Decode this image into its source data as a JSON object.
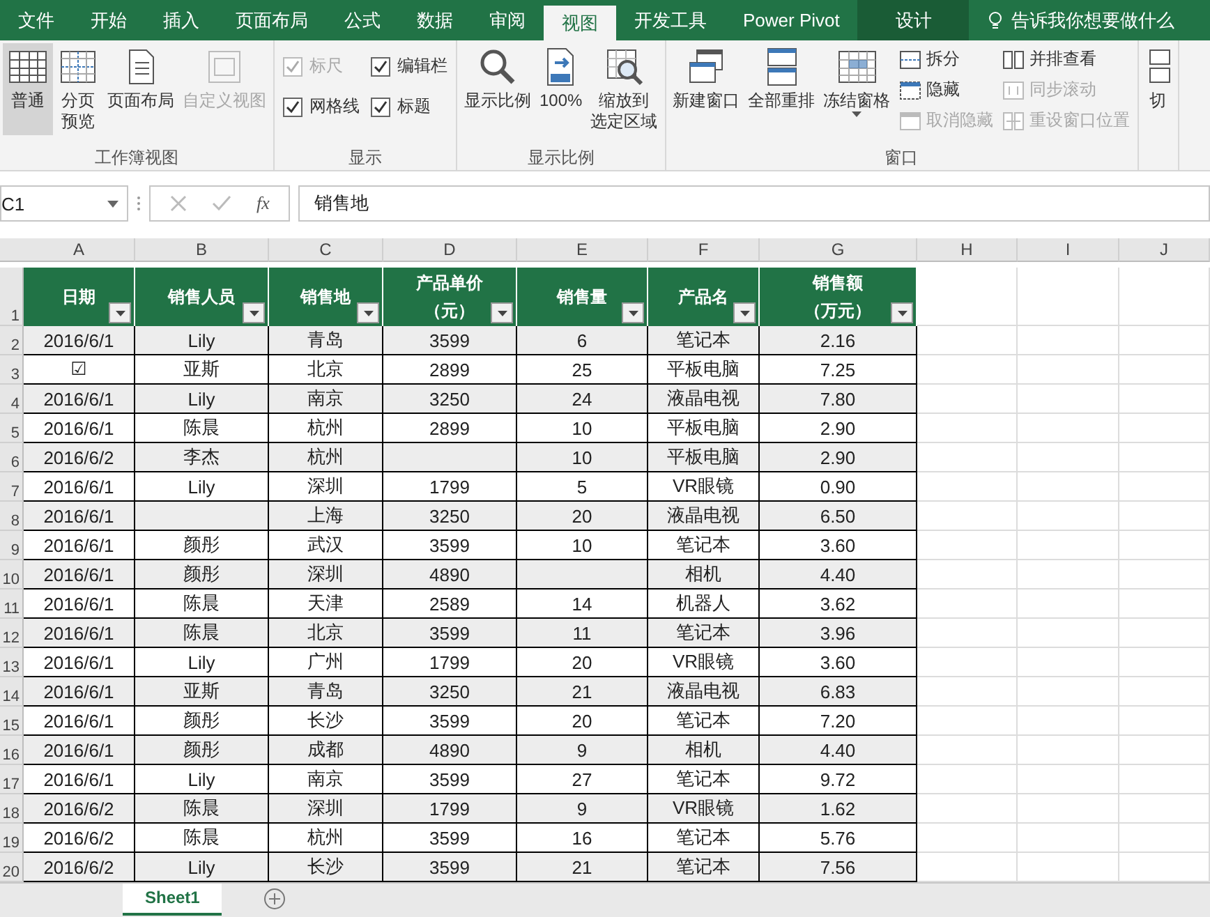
{
  "tabs": [
    {
      "label": "文件",
      "selected": false,
      "kind": "normal"
    },
    {
      "label": "开始",
      "selected": false,
      "kind": "normal"
    },
    {
      "label": "插入",
      "selected": false,
      "kind": "normal"
    },
    {
      "label": "页面布局",
      "selected": false,
      "kind": "normal"
    },
    {
      "label": "公式",
      "selected": false,
      "kind": "normal"
    },
    {
      "label": "数据",
      "selected": false,
      "kind": "normal"
    },
    {
      "label": "审阅",
      "selected": false,
      "kind": "normal"
    },
    {
      "label": "视图",
      "selected": true,
      "kind": "normal"
    },
    {
      "label": "开发工具",
      "selected": false,
      "kind": "normal"
    },
    {
      "label": "Power Pivot",
      "selected": false,
      "kind": "normal"
    },
    {
      "label": "设计",
      "selected": false,
      "kind": "contextual"
    }
  ],
  "tell_me": {
    "text": "告诉我你想要做什么"
  },
  "ribbon_groups": [
    {
      "label": "工作簿视图",
      "items": [
        {
          "kind": "large",
          "lines": [
            "普通"
          ],
          "selected": true,
          "disabled": false
        },
        {
          "kind": "large",
          "lines": [
            "分页",
            "预览"
          ],
          "selected": false,
          "disabled": false
        },
        {
          "kind": "large",
          "lines": [
            "页面布局"
          ],
          "selected": false,
          "disabled": false
        },
        {
          "kind": "large",
          "lines": [
            "自定义视图"
          ],
          "selected": false,
          "disabled": true
        }
      ]
    },
    {
      "label": "显示",
      "items": [
        {
          "kind": "check",
          "lines": [
            "标尺"
          ],
          "checked": true,
          "disabled": true
        },
        {
          "kind": "check",
          "lines": [
            "编辑栏"
          ],
          "checked": true,
          "disabled": false
        },
        {
          "kind": "check",
          "lines": [
            "网格线"
          ],
          "checked": true,
          "disabled": false
        },
        {
          "kind": "check",
          "lines": [
            "标题"
          ],
          "checked": true,
          "disabled": false
        }
      ]
    },
    {
      "label": "显示比例",
      "items": [
        {
          "kind": "large",
          "lines": [
            "显示比例"
          ],
          "disabled": false
        },
        {
          "kind": "large",
          "lines": [
            "100%"
          ],
          "disabled": false
        },
        {
          "kind": "large",
          "lines": [
            "缩放到",
            "选定区域"
          ],
          "disabled": false
        }
      ]
    },
    {
      "label": "窗口",
      "items": [
        {
          "kind": "large",
          "lines": [
            "新建窗口"
          ],
          "disabled": false
        },
        {
          "kind": "large",
          "lines": [
            "全部重排"
          ],
          "disabled": false
        },
        {
          "kind": "large",
          "lines": [
            "冻结窗格"
          ],
          "disabled": false,
          "dropdown": true
        },
        {
          "kind": "small",
          "lines": [
            "拆分"
          ],
          "disabled": false
        },
        {
          "kind": "small",
          "lines": [
            "隐藏"
          ],
          "disabled": false
        },
        {
          "kind": "small",
          "lines": [
            "取消隐藏"
          ],
          "disabled": true
        },
        {
          "kind": "small",
          "lines": [
            "并排查看"
          ],
          "disabled": false
        },
        {
          "kind": "small",
          "lines": [
            "同步滚动"
          ],
          "disabled": true
        },
        {
          "kind": "small",
          "lines": [
            "重设窗口位置"
          ],
          "disabled": true
        }
      ]
    },
    {
      "items": [
        {
          "kind": "large",
          "lines": [
            "切"
          ],
          "disabled": false
        }
      ]
    }
  ],
  "formula_bar": {
    "name_box": "C1",
    "fx": "fx",
    "formula": "销售地"
  },
  "sheet": {
    "columns": [
      "A",
      "B",
      "C",
      "D",
      "E",
      "F",
      "G",
      "H",
      "I",
      "J"
    ],
    "row_numbers": [
      "1",
      "2",
      "3",
      "4",
      "5",
      "6",
      "7",
      "8",
      "9",
      "10",
      "11",
      "12",
      "13",
      "14",
      "15",
      "16",
      "17",
      "18",
      "19",
      "20"
    ],
    "header": [
      [
        "日期"
      ],
      [
        "销售人员"
      ],
      [
        "销售地"
      ],
      [
        "产品单价",
        "（元）"
      ],
      [
        "销售量"
      ],
      [
        "产品名"
      ],
      [
        "销售额",
        "（万元）"
      ]
    ],
    "rows": [
      [
        "2016/6/1",
        "Lily",
        "青岛",
        "3599",
        "6",
        "笔记本",
        "2.16"
      ],
      [
        "☑",
        "亚斯",
        "北京",
        "2899",
        "25",
        "平板电脑",
        "7.25"
      ],
      [
        "2016/6/1",
        "Lily",
        "南京",
        "3250",
        "24",
        "液晶电视",
        "7.80"
      ],
      [
        "2016/6/1",
        "陈晨",
        "杭州",
        "2899",
        "10",
        "平板电脑",
        "2.90"
      ],
      [
        "2016/6/2",
        "李杰",
        "杭州",
        null,
        "10",
        "平板电脑",
        "2.90"
      ],
      [
        "2016/6/1",
        "Lily",
        "深圳",
        "1799",
        "5",
        "VR眼镜",
        "0.90"
      ],
      [
        "2016/6/1",
        null,
        "上海",
        "3250",
        "20",
        "液晶电视",
        "6.50"
      ],
      [
        "2016/6/1",
        "颜彤",
        "武汉",
        "3599",
        "10",
        "笔记本",
        "3.60"
      ],
      [
        "2016/6/1",
        "颜彤",
        "深圳",
        "4890",
        null,
        "相机",
        "4.40"
      ],
      [
        "2016/6/1",
        "陈晨",
        "天津",
        "2589",
        "14",
        "机器人",
        "3.62"
      ],
      [
        "2016/6/1",
        "陈晨",
        "北京",
        "3599",
        "11",
        "笔记本",
        "3.96"
      ],
      [
        "2016/6/1",
        "Lily",
        "广州",
        "1799",
        "20",
        "VR眼镜",
        "3.60"
      ],
      [
        "2016/6/1",
        "亚斯",
        "青岛",
        "3250",
        "21",
        "液晶电视",
        "6.83"
      ],
      [
        "2016/6/1",
        "颜彤",
        "长沙",
        "3599",
        "20",
        "笔记本",
        "7.20"
      ],
      [
        "2016/6/1",
        "颜彤",
        "成都",
        "4890",
        "9",
        "相机",
        "4.40"
      ],
      [
        "2016/6/1",
        "Lily",
        "南京",
        "3599",
        "27",
        "笔记本",
        "9.72"
      ],
      [
        "2016/6/2",
        "陈晨",
        "深圳",
        "1799",
        "9",
        "VR眼镜",
        "1.62"
      ],
      [
        "2016/6/2",
        "陈晨",
        "杭州",
        "3599",
        "16",
        "笔记本",
        "5.76"
      ],
      [
        "2016/6/2",
        "Lily",
        "长沙",
        "3599",
        "21",
        "笔记本",
        "7.56"
      ]
    ]
  },
  "sheet_tabs": [
    {
      "label": "Sheet1",
      "selected": true
    }
  ]
}
